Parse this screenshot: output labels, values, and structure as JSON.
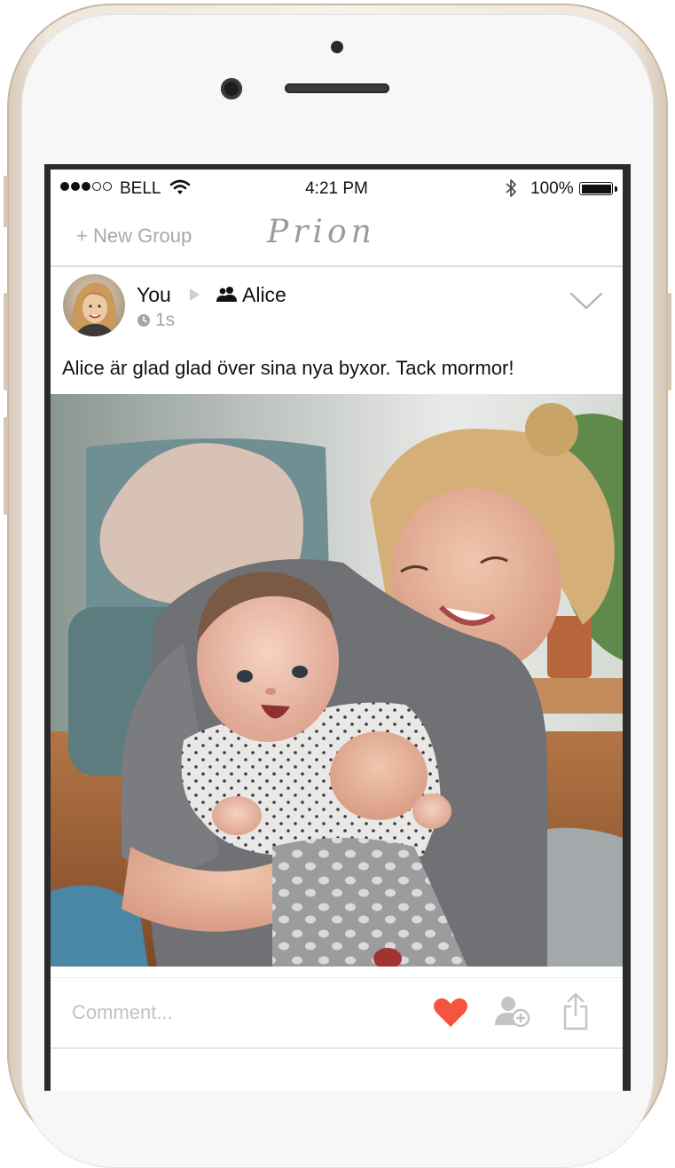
{
  "status_bar": {
    "signal_bars_filled": 3,
    "signal_bars_total": 5,
    "carrier": "BELL",
    "time": "4:21 PM",
    "battery_percent_label": "100%",
    "battery_level": 1.0
  },
  "header": {
    "new_group_label": "+ New Group",
    "logo_text": "Prion"
  },
  "post": {
    "author": "You",
    "recipient": "Alice",
    "time_ago": "1s",
    "caption": "Alice är glad glad över sina nya byxor. Tack mormor!"
  },
  "comment_bar": {
    "placeholder": "Comment...",
    "like_color": "#f5553f",
    "icon_color": "#c4c4c4"
  },
  "icons": [
    "wifi-icon",
    "bluetooth-icon",
    "group-icon",
    "clock-icon",
    "chevron-down-icon",
    "heart-icon",
    "add-person-icon",
    "share-icon"
  ]
}
